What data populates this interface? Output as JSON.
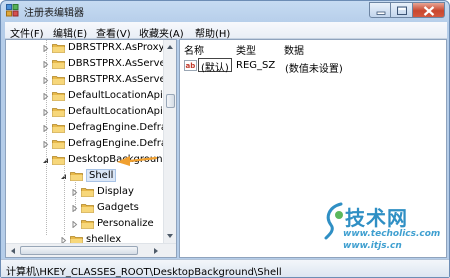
{
  "window": {
    "title": "注册表编辑器",
    "controls": {
      "minimize": "minimize-icon",
      "maximize": "maximize-icon",
      "close": "close-icon"
    }
  },
  "menu": [
    "文件(F)",
    "编辑(E)",
    "查看(V)",
    "收藏夹(A)",
    "帮助(H)"
  ],
  "tree": {
    "items": [
      {
        "label": "DBRSTPRX.AsProxy.1",
        "expandable": true,
        "expanded": false,
        "selected": false
      },
      {
        "label": "DBRSTPRX.AsServer",
        "expandable": true,
        "expanded": false,
        "selected": false
      },
      {
        "label": "DBRSTPRX.AsServer.1",
        "expandable": true,
        "expanded": false,
        "selected": false
      },
      {
        "label": "DefaultLocationApi",
        "expandable": true,
        "expanded": false,
        "selected": false
      },
      {
        "label": "DefaultLocationApi.1",
        "expandable": true,
        "expanded": false,
        "selected": false
      },
      {
        "label": "DefragEngine.DefragE",
        "expandable": true,
        "expanded": false,
        "selected": false
      },
      {
        "label": "DefragEngine.DefragE",
        "expandable": true,
        "expanded": false,
        "selected": false
      },
      {
        "label": "DesktopBackground",
        "expandable": true,
        "expanded": true,
        "selected": false
      },
      {
        "label": "Shell",
        "expandable": true,
        "expanded": true,
        "selected": true
      },
      {
        "label": "Display",
        "expandable": true,
        "expanded": false,
        "selected": false
      },
      {
        "label": "Gadgets",
        "expandable": true,
        "expanded": false,
        "selected": false
      },
      {
        "label": "Personalize",
        "expandable": true,
        "expanded": false,
        "selected": false
      },
      {
        "label": "shellex",
        "expandable": true,
        "expanded": false,
        "selected": false
      },
      {
        "label": "device",
        "expandable": true,
        "expanded": false,
        "selected": false
      }
    ]
  },
  "list": {
    "headers": {
      "name": "名称",
      "type": "类型",
      "data": "数据"
    },
    "rows": [
      {
        "icon": "string-value-icon",
        "name": "(默认)",
        "type": "REG_SZ",
        "data": "(数值未设置)"
      }
    ]
  },
  "status": {
    "path": "计算机\\HKEY_CLASSES_ROOT\\DesktopBackground\\Shell"
  },
  "watermark": {
    "logo": "技术网",
    "line1": "www.techolics.com",
    "line2": "www.itjs.cn"
  },
  "colors": {
    "arrow": "#f0a030",
    "selection": "#dbe7f7",
    "folder": "#e8b94a"
  }
}
